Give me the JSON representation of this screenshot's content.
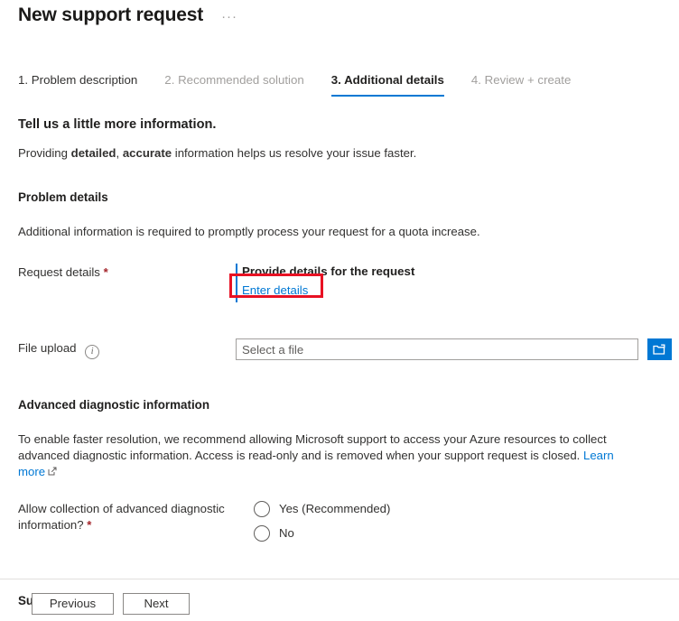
{
  "header": {
    "title": "New support request",
    "more_menu": "···"
  },
  "tabs": [
    {
      "label": "1. Problem description",
      "state": "complete"
    },
    {
      "label": "2. Recommended solution",
      "state": "disabled"
    },
    {
      "label": "3. Additional details",
      "state": "active"
    },
    {
      "label": "4. Review + create",
      "state": "disabled"
    }
  ],
  "intro": {
    "heading": "Tell us a little more information.",
    "sub_prefix": "Providing ",
    "sub_bold1": "detailed",
    "sub_mid": ", ",
    "sub_bold2": "accurate",
    "sub_suffix": " information helps us resolve your issue faster."
  },
  "problem_details": {
    "section_title": "Problem details",
    "description": "Additional information is required to promptly process your request for a quota increase.",
    "request_details_label": "Request details",
    "request_details_required": "*",
    "provide_details_title": "Provide details for the request",
    "enter_details_link": "Enter details",
    "highlight_color": "#e81123",
    "accent_bar_color": "#0078d4"
  },
  "file_upload": {
    "label": "File upload",
    "info_icon": "info-icon",
    "info_glyph": "i",
    "placeholder": "Select a file",
    "value": "",
    "browse_icon": "folder-icon",
    "browse_button_color": "#0078d4"
  },
  "advanced_diagnostic": {
    "section_title": "Advanced diagnostic information",
    "description": "To enable faster resolution, we recommend allowing Microsoft support to access your Azure resources to collect advanced diagnostic information. Access is read-only and is removed when your support request is closed. ",
    "learn_more": "Learn more",
    "external_icon": "external-link-icon",
    "question_line1": "Allow collection of advanced diagnostic",
    "question_line2": "information?",
    "question_required": "*",
    "options": [
      {
        "label": "Yes (Recommended)",
        "selected": false
      },
      {
        "label": "No",
        "selected": false
      }
    ]
  },
  "support_method": {
    "section_title": "Support method"
  },
  "footer": {
    "previous_label": "Previous",
    "next_label": "Next"
  }
}
